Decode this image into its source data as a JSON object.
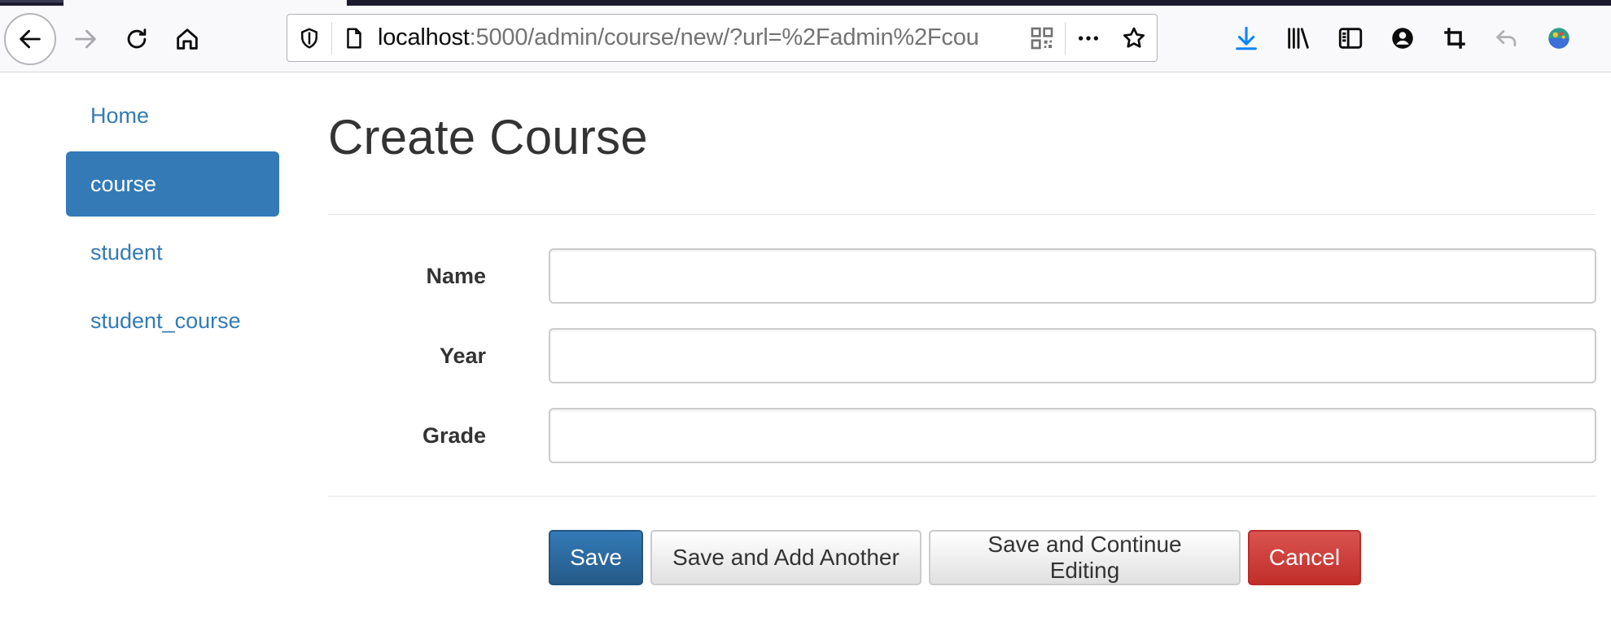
{
  "browser": {
    "url_host": "localhost",
    "url_rest": ":5000/admin/course/new/?url=%2Fadmin%2Fcou",
    "icons": {
      "back": "arrow-left-icon",
      "forward": "arrow-right-icon",
      "reload": "reload-icon",
      "home": "home-icon",
      "tracking": "shield-icon",
      "page": "page-icon",
      "qr": "qr-code-icon",
      "more": "more-dots-icon",
      "bookmark": "star-icon",
      "download": "download-icon",
      "library": "library-icon",
      "sidebar": "sidebar-icon",
      "account": "account-icon",
      "screenshot": "crop-icon",
      "undo": "undo-icon",
      "extension": "extension-icon"
    },
    "colors": {
      "download": "#0a84ff"
    }
  },
  "sidebar": {
    "items": [
      {
        "label": "Home",
        "active": false
      },
      {
        "label": "course",
        "active": true
      },
      {
        "label": "student",
        "active": false
      },
      {
        "label": "student_course",
        "active": false
      }
    ]
  },
  "page": {
    "title": "Create Course",
    "fields": [
      {
        "label": "Name",
        "value": ""
      },
      {
        "label": "Year",
        "value": ""
      },
      {
        "label": "Grade",
        "value": ""
      }
    ],
    "buttons": {
      "save": "Save",
      "save_add": "Save and Add Another",
      "save_continue": "Save and Continue Editing",
      "cancel": "Cancel"
    }
  },
  "colors": {
    "primary": "#337ab7",
    "danger": "#d9534f"
  }
}
